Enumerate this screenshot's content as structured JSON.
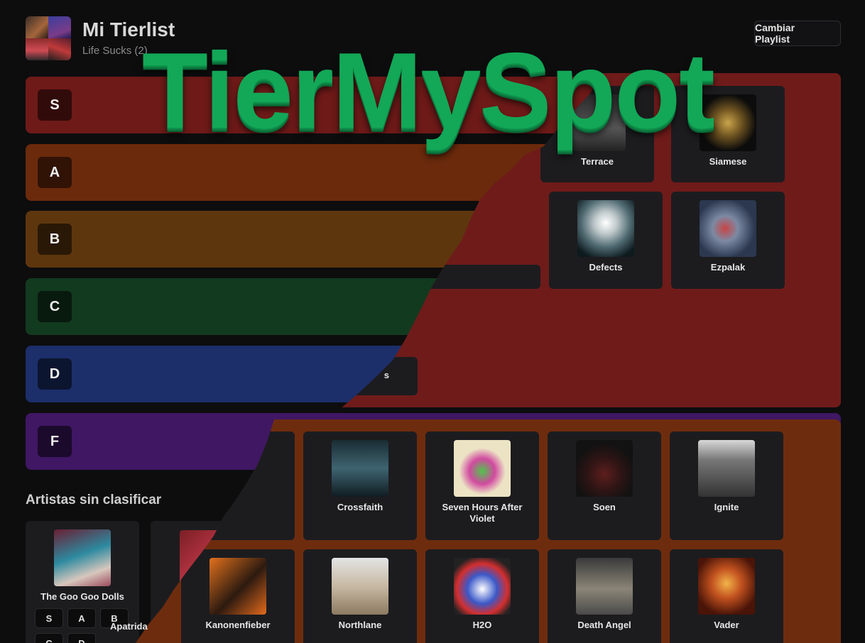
{
  "header": {
    "title": "Mi Tierlist",
    "subtitle": "Life Sucks (2)",
    "change_playlist_label": "Cambiar Playlist"
  },
  "watermark": "TierMySpot",
  "tiers": [
    {
      "label": "S",
      "color": "#6e1a18"
    },
    {
      "label": "A",
      "color": "#6b2a0c"
    },
    {
      "label": "B",
      "color": "#5e360e"
    },
    {
      "label": "C",
      "color": "#123a1f"
    },
    {
      "label": "D",
      "color": "#1c2f6b"
    },
    {
      "label": "F",
      "color": "#3f1763"
    }
  ],
  "overlay": {
    "red_color": "#6f1b1a",
    "orange_color": "#6e2c0e",
    "cards_top": [
      {
        "name": "Terrace"
      },
      {
        "name": "Siamese"
      },
      {
        "name": "Defects"
      },
      {
        "name": "Ezpalak"
      }
    ],
    "cards_bottom": [
      {
        "name": "Crossfaith"
      },
      {
        "name": "Seven Hours After Violet"
      },
      {
        "name": "Soen"
      },
      {
        "name": "Ignite"
      },
      {
        "name": "Kanonenfieber"
      },
      {
        "name": "Northlane"
      },
      {
        "name": "H2O"
      },
      {
        "name": "Death Angel"
      },
      {
        "name": "Vader"
      }
    ],
    "partial_texts": [
      "Apatrida",
      "s"
    ]
  },
  "unranked": {
    "title": "Artistas sin clasificar",
    "cards": [
      {
        "name": "The Goo Goo Dolls",
        "buttons": [
          "S",
          "A",
          "B",
          "C",
          "D"
        ]
      }
    ]
  }
}
